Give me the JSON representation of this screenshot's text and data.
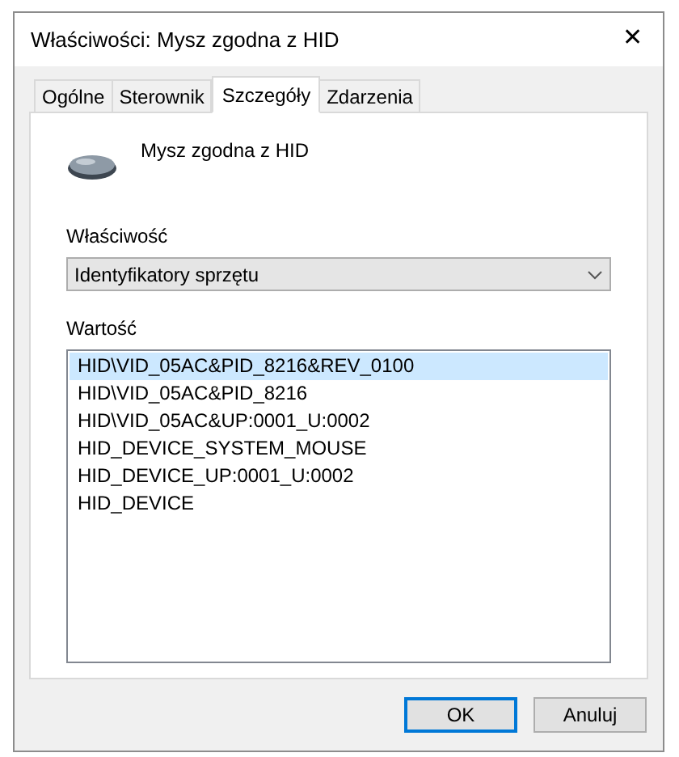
{
  "window": {
    "title": "Właściwości: Mysz zgodna z HID",
    "close": "✕"
  },
  "tabs": [
    {
      "label": "Ogólne",
      "selected": false
    },
    {
      "label": "Sterownik",
      "selected": false
    },
    {
      "label": "Szczegóły",
      "selected": true
    },
    {
      "label": "Zdarzenia",
      "selected": false
    }
  ],
  "device": {
    "name": "Mysz zgodna z HID"
  },
  "property": {
    "label": "Właściwość",
    "value": "Identyfikatory sprzętu"
  },
  "values": {
    "label": "Wartość",
    "items": [
      {
        "text": "HID\\VID_05AC&PID_8216&REV_0100",
        "selected": true
      },
      {
        "text": "HID\\VID_05AC&PID_8216",
        "selected": false
      },
      {
        "text": "HID\\VID_05AC&UP:0001_U:0002",
        "selected": false
      },
      {
        "text": "HID_DEVICE_SYSTEM_MOUSE",
        "selected": false
      },
      {
        "text": "HID_DEVICE_UP:0001_U:0002",
        "selected": false
      },
      {
        "text": "HID_DEVICE",
        "selected": false
      }
    ]
  },
  "buttons": [
    {
      "label": "OK",
      "kind": "default"
    },
    {
      "label": "Anuluj",
      "kind": "normal"
    }
  ]
}
